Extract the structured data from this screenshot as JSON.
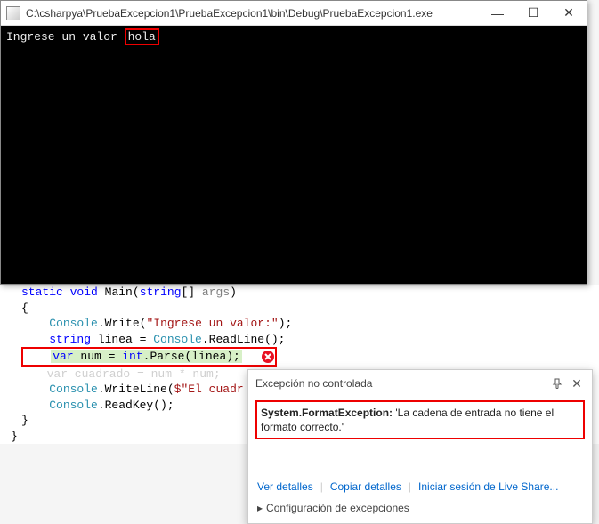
{
  "console": {
    "title": "C:\\csharpya\\PruebaExcepcion1\\PruebaExcepcion1\\bin\\Debug\\PruebaExcepcion1.exe",
    "prompt_text": "Ingrese un valor ",
    "user_input": "hola",
    "buttons": {
      "min": "—",
      "max": "☐",
      "close": "✕"
    }
  },
  "code": {
    "sig_static": "static",
    "sig_void": "void",
    "sig_main": "Main",
    "sig_paren_open": "(",
    "sig_string": "string",
    "sig_brackets": "[]",
    "sig_args": "args",
    "sig_paren_close": ")",
    "brace_open": "{",
    "l1_console": "Console",
    "l1_dot": ".",
    "l1_write": "Write",
    "l1_str": "\"Ingrese un valor:\"",
    "l1_end": ";",
    "l2_string": "string",
    "l2_linea": " linea = ",
    "l2_console": "Console",
    "l2_readline": ".ReadLine();",
    "l3_var": "var",
    "l3_num": " num = ",
    "l3_int": "int",
    "l3_parse": ".Parse(linea);",
    "l4_hidden": "var cuadrado = num * num;",
    "l5_console": "Console",
    "l5_writeline": ".WriteLine(",
    "l5_str": "$\"El cuadr",
    "l6_console": "Console",
    "l6_readkey": ".ReadKey();",
    "brace_close1": "}",
    "brace_close2": "}"
  },
  "popup": {
    "title": "Excepción no controlada",
    "pin": "📌",
    "close": "✕",
    "exception_name": "System.FormatException:",
    "exception_msg": " 'La cadena de entrada no tiene el formato correcto.'",
    "link_details": "Ver detalles",
    "link_copy": "Copiar detalles",
    "link_liveshare": "Iniciar sesión de Live Share...",
    "config": "Configuración de excepciones",
    "tri": "▸"
  }
}
